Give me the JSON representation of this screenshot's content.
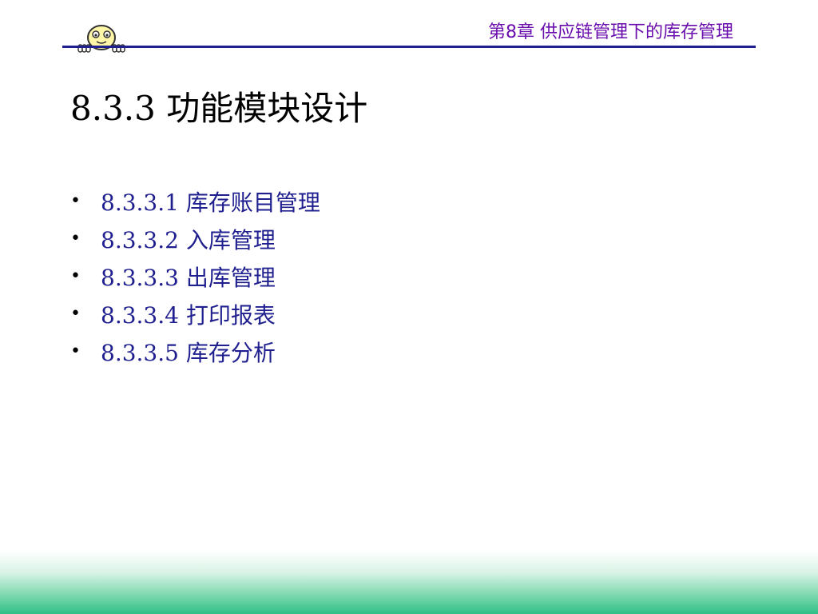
{
  "header": {
    "chapter_title": "第8章  供应链管理下的库存管理"
  },
  "slide": {
    "section_title": "8.3.3  功能模块设计",
    "bullets": [
      {
        "text": "8.3.3.1 库存账目管理"
      },
      {
        "text": "8.3.3.2 入库管理"
      },
      {
        "text": "8.3.3.3 出库管理"
      },
      {
        "text": "8.3.3.4 打印报表"
      },
      {
        "text": "8.3.3.5 库存分析"
      }
    ],
    "bullet_symbol": "•"
  },
  "colors": {
    "chapter_title": "#6a0dad",
    "header_rule": "#1f1f8f",
    "bullet_text": "#1f1f8f",
    "footer_gradient_end": "#2fbf86"
  },
  "icons": {
    "mascot": "peeking-face-icon"
  }
}
